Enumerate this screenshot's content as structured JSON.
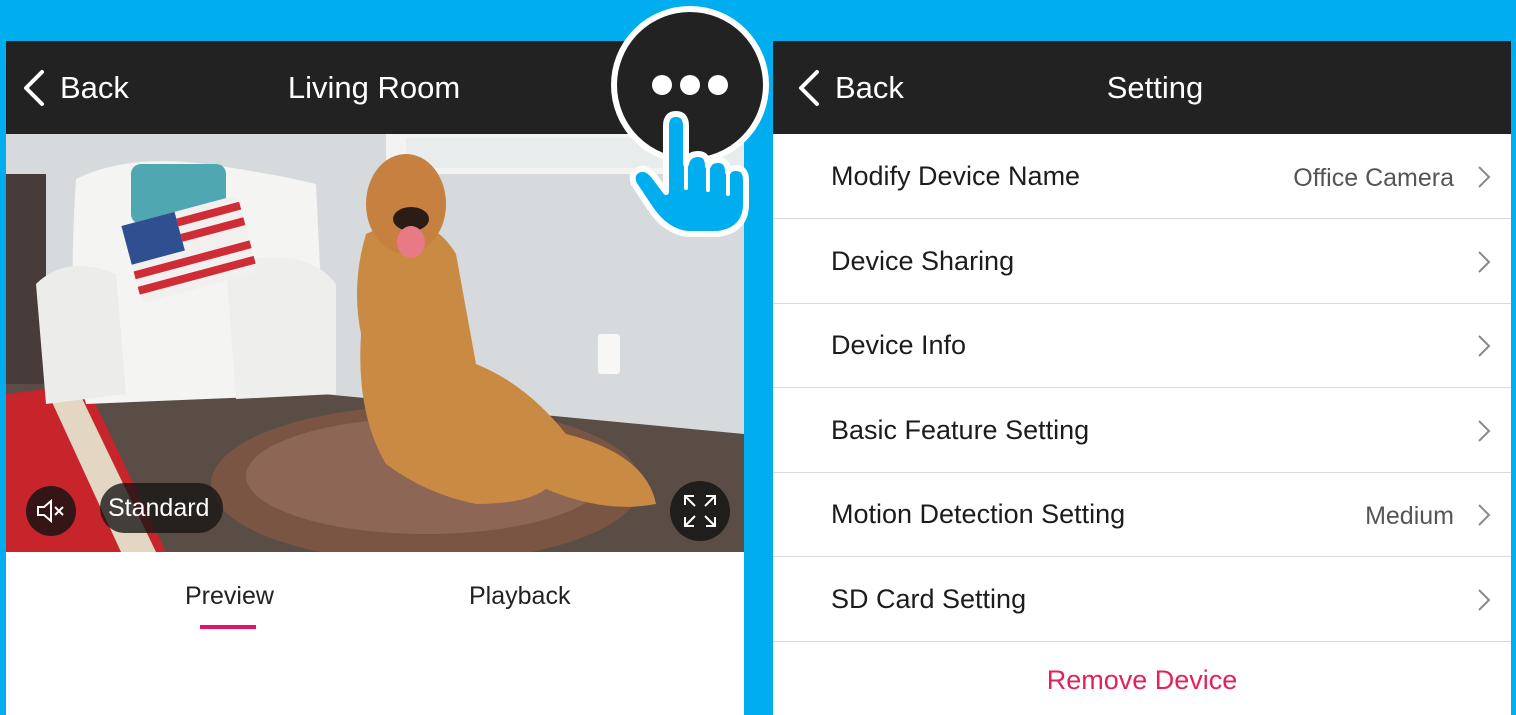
{
  "left_screen": {
    "back_label": "Back",
    "title": "Living Room",
    "quality_label": "Standard",
    "tabs": [
      {
        "label": "Preview",
        "active": true
      },
      {
        "label": "Playback",
        "active": false
      }
    ],
    "icons": {
      "back": "chevron-left-icon",
      "more": "more-dots-icon",
      "mute": "speaker-muted-icon",
      "fullscreen": "fullscreen-icon",
      "pointer": "hand-pointer-icon"
    }
  },
  "right_screen": {
    "back_label": "Back",
    "title": "Setting",
    "rows": [
      {
        "label": "Modify Device Name",
        "value": "Office Camera"
      },
      {
        "label": "Device Sharing",
        "value": ""
      },
      {
        "label": "Device Info",
        "value": ""
      },
      {
        "label": "Basic Feature Setting",
        "value": ""
      },
      {
        "label": "Motion Detection Setting",
        "value": "Medium"
      },
      {
        "label": "SD Card Setting",
        "value": ""
      }
    ],
    "remove_label": "Remove Device"
  },
  "colors": {
    "background": "#00aeef",
    "topbar": "#222223",
    "accent": "#e0146a",
    "remove": "#e5215a"
  }
}
